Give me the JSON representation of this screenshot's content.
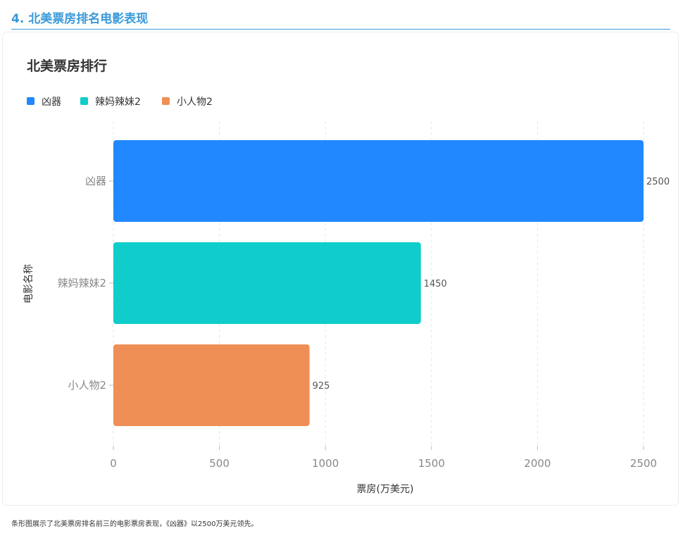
{
  "section": {
    "title": "4. 北美票房排名电影表现"
  },
  "chart_data": {
    "type": "bar",
    "orientation": "horizontal",
    "title": "北美票房排行",
    "categories": [
      "凶器",
      "辣妈辣妹2",
      "小人物2"
    ],
    "values": [
      2500,
      1450,
      925
    ],
    "colors": [
      "#2188ff",
      "#0fcdcb",
      "#f08f55"
    ],
    "legend": [
      "凶器",
      "辣妈辣妹2",
      "小人物2"
    ],
    "legend_position": "top-left",
    "xlabel": "票房(万美元)",
    "ylabel": "电影名称",
    "xlim": [
      0,
      2500
    ],
    "xticks": [
      "0",
      "500",
      "1000",
      "1500",
      "2000",
      "2500"
    ],
    "data_labels": [
      "2500",
      "1450",
      "925"
    ],
    "grid": "vertical-dashed"
  },
  "caption": "条形图展示了北美票房排名前三的电影票房表现，《凶器》以2500万美元领先。"
}
